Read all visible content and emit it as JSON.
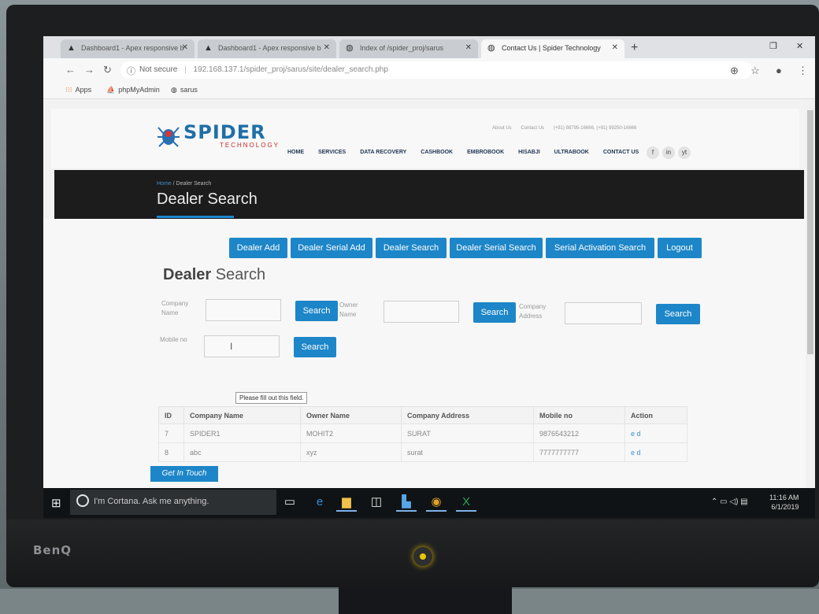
{
  "browser": {
    "tabs": [
      {
        "title": "Dashboard1 - Apex responsive b",
        "icon": "apex-icon",
        "active": false
      },
      {
        "title": "Dashboard1 - Apex responsive b",
        "icon": "apex-icon",
        "active": false
      },
      {
        "title": "Index of /spider_proj/sarus",
        "icon": "globe-icon",
        "active": false
      },
      {
        "title": "Contact Us | Spider Technology",
        "icon": "globe-icon",
        "active": true
      }
    ],
    "security_label": "Not secure",
    "url": "192.168.137.1/spider_proj/sarus/site/dealer_search.php",
    "bookmarks": [
      {
        "label": "Apps",
        "icon": "apps-grid-icon"
      },
      {
        "label": "phpMyAdmin",
        "icon": "phpmyadmin-icon"
      },
      {
        "label": "sarus",
        "icon": "globe-icon"
      }
    ]
  },
  "site": {
    "logo_title": "SPIDER",
    "logo_sub": "TECHNOLOGY",
    "topline": [
      "About Us",
      "Contact Us",
      "(+91) 98795-16666, (+91) 99250-16666"
    ],
    "nav": [
      "HOME",
      "SERVICES",
      "DATA RECOVERY",
      "CASHBOOK",
      "EMBROBOOK",
      "HISABJI",
      "ULTRABOOK",
      "CONTACT US"
    ],
    "social": [
      "f",
      "in",
      "yt"
    ]
  },
  "banner": {
    "breadcrumb_home": "Home",
    "breadcrumb_sep": "/",
    "breadcrumb_current": "Dealer Search",
    "title": "Dealer Search"
  },
  "actions": [
    "Dealer Add",
    "Dealer Serial Add",
    "Dealer Search",
    "Dealer Serial Search",
    "Serial Activation Search",
    "Logout"
  ],
  "section_title_bold": "Dealer",
  "section_title_rest": " Search",
  "form": {
    "company_name_label": "Company Name",
    "owner_name_label": "Owner Name",
    "company_address_label": "Company Address",
    "mobile_label": "Mobile no",
    "search_label": "Search",
    "tooltip": "Please fill out this field."
  },
  "table": {
    "columns": [
      "ID",
      "Company Name",
      "Owner Name",
      "Company Address",
      "Mobile no",
      "Action"
    ],
    "rows": [
      [
        "7",
        "SPIDER1",
        "MOHIT2",
        "SURAT",
        "9876543212",
        "e d"
      ],
      [
        "8",
        "abc",
        "xyz",
        "surat",
        "7777777777",
        "e d"
      ]
    ]
  },
  "footer_tab": "Get In Touch",
  "taskbar": {
    "cortana_placeholder": "I'm Cortana. Ask me anything.",
    "time": "11:16 AM",
    "date": "6/1/2019"
  },
  "monitor_brand": "BenQ"
}
